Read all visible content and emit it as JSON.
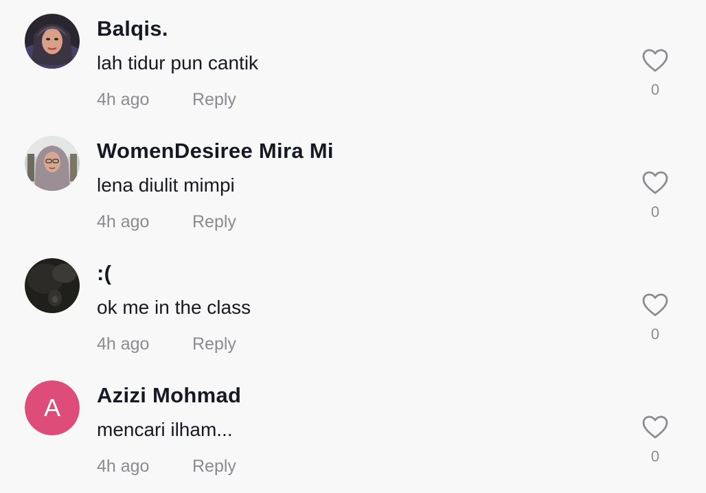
{
  "comments": [
    {
      "username": "Balqis.",
      "text": "lah tidur pun cantik",
      "time": "4h ago",
      "reply_label": "Reply",
      "likes": "0",
      "avatar_type": "photo"
    },
    {
      "username": "WomenDesiree Mira Mi",
      "text": "lena diulit mimpi",
      "time": "4h ago",
      "reply_label": "Reply",
      "likes": "0",
      "avatar_type": "photo"
    },
    {
      "username": ":(",
      "text": "ok me in the class",
      "time": "4h ago",
      "reply_label": "Reply",
      "likes": "0",
      "avatar_type": "photo"
    },
    {
      "username": "Azizi Mohmad",
      "text": "mencari ilham...",
      "time": "4h ago",
      "reply_label": "Reply",
      "likes": "0",
      "avatar_type": "letter",
      "avatar_letter": "A",
      "avatar_color": "#de4d7a"
    }
  ],
  "colors": {
    "background": "#f8f8f8",
    "username": "#161823",
    "meta": "#8a8b91",
    "heart_outline": "#8a8b91"
  },
  "icons": {
    "like": "heart-outline-icon"
  }
}
